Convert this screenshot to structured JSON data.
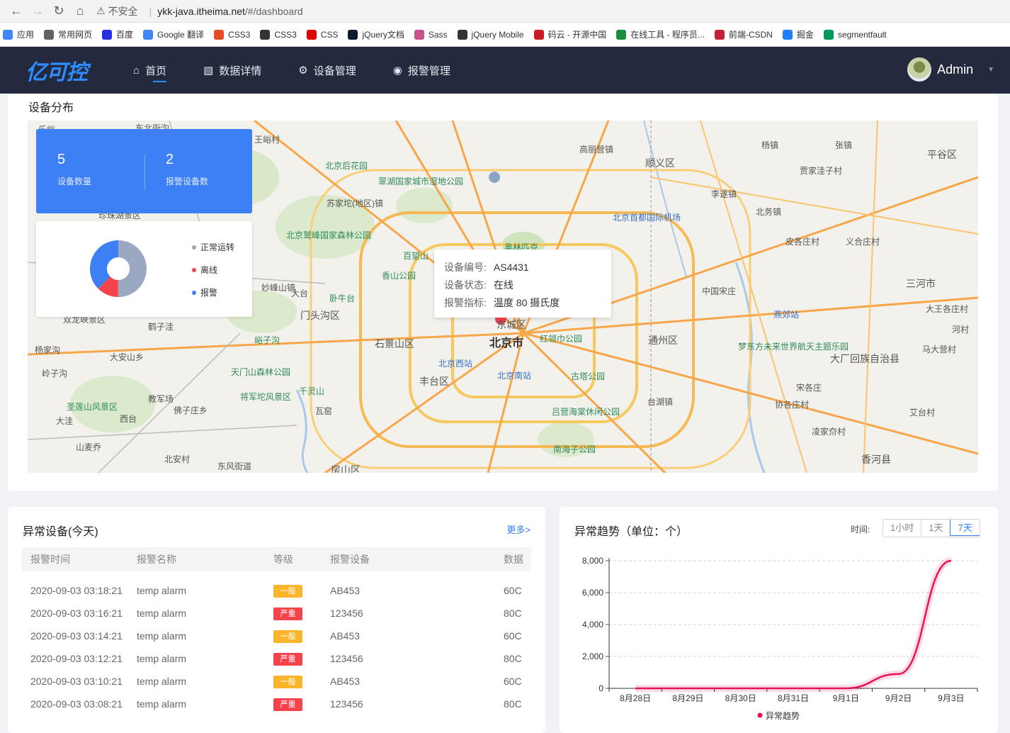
{
  "browser": {
    "not_secure": "不安全",
    "host": "ykk-java.itheima.net",
    "path": "/#/dashboard"
  },
  "bookmarks": [
    {
      "label": "应用",
      "color": "#4285f4"
    },
    {
      "label": "常用网页",
      "color": "#5f6368"
    },
    {
      "label": "百度",
      "color": "#2932e1"
    },
    {
      "label": "Google 翻译",
      "color": "#4285f4"
    },
    {
      "label": "CSS3",
      "color": "#e44d26"
    },
    {
      "label": "CSS3",
      "color": "#333333"
    },
    {
      "label": "CSS",
      "color": "#e00000"
    },
    {
      "label": "jQuery文档",
      "color": "#0f1b2d"
    },
    {
      "label": "Sass",
      "color": "#c6538c"
    },
    {
      "label": "jQuery Mobile",
      "color": "#333333"
    },
    {
      "label": "码云 - 开源中国",
      "color": "#c71d23"
    },
    {
      "label": "在线工具 - 程序员...",
      "color": "#1a8f3c"
    },
    {
      "label": "前端-CSDN",
      "color": "#c32136"
    },
    {
      "label": "掘金",
      "color": "#1e80ff"
    },
    {
      "label": "segmentfault",
      "color": "#009a61"
    }
  ],
  "header": {
    "logo": "亿可控",
    "nav": [
      {
        "label": "首页",
        "icon": "home-icon",
        "active": true
      },
      {
        "label": "数据详情",
        "icon": "chart-icon"
      },
      {
        "label": "设备管理",
        "icon": "gear-icon"
      },
      {
        "label": "报警管理",
        "icon": "signal-icon"
      }
    ],
    "user": "Admin"
  },
  "device_distribution": {
    "title": "设备分布",
    "device_count": "5",
    "device_count_label": "设备数量",
    "alarm_device_count": "2",
    "alarm_device_label": "报警设备数",
    "pie_legend": [
      {
        "label": "正常运转",
        "color": "#9aa8c2"
      },
      {
        "label": "离线",
        "color": "#f5434c"
      },
      {
        "label": "报警",
        "color": "#3d7ff5"
      }
    ],
    "tooltip": {
      "code_key": "设备编号:",
      "code_val": "AS4431",
      "status_key": "设备状态:",
      "status_val": "在线",
      "metric_key": "报警指标:",
      "metric_val": "温度 80 摄氏度"
    },
    "map_labels": [
      "北京市",
      "东城区",
      "石景山区",
      "门头沟区",
      "丰台区",
      "通州区",
      "顺义区",
      "平谷区",
      "三河市",
      "大厂回族自治县",
      "香河县",
      "房山区",
      "北京首都国际机场",
      "北京西站",
      "北京南站",
      "燕郊站",
      "奥林匹克",
      "百望山",
      "香山公园",
      "卧牛台",
      "北京后花园",
      "翠湖国家城市湿地公园",
      "北京鹫峰国家森林公园",
      "红领巾公园",
      "古塔公园",
      "吕营海棠休闲公园",
      "南海子公园",
      "梦东方未来世界航天主题乐园",
      "天门山森林公园",
      "将军坨风景区",
      "千灵山",
      "圣莲山风景区",
      "峪子沟",
      "高丽营镇",
      "杨镇",
      "张镇",
      "李遂镇",
      "北务镇",
      "皮各庄村",
      "义合庄村",
      "中国宋庄",
      "台湖镇",
      "宋各庄",
      "协各庄村",
      "凌家夼村",
      "艾台村",
      "马大营村",
      "河村",
      "大王各庄村",
      "贾家洼子村",
      "苏家坨(地区)镇",
      "妙峰山镇",
      "大台",
      "鹤子洼",
      "大安山乡",
      "杨家沟",
      "岭子沟",
      "佛子庄乡",
      "教军场",
      "西台",
      "大洼",
      "山麦乔",
      "北安村",
      "东风街道",
      "瓦窑",
      "珍珠湖景区",
      "双龙峡景区",
      "东北街沟",
      "王峪村",
      "乐峪"
    ]
  },
  "abnormal_devices": {
    "title": "异常设备(今天)",
    "more": "更多>",
    "columns": [
      "报警时间",
      "报警名称",
      "等级",
      "报警设备",
      "数据"
    ],
    "rows": [
      {
        "time": "2020-09-03 03:18:21",
        "name": "temp alarm",
        "level": "一般",
        "level_color": "#fbb52c",
        "device": "AB453",
        "data": "60C"
      },
      {
        "time": "2020-09-03 03:16:21",
        "name": "temp alarm",
        "level": "严重",
        "level_color": "#f5434c",
        "device": "123456",
        "data": "80C"
      },
      {
        "time": "2020-09-03 03:14:21",
        "name": "temp alarm",
        "level": "一般",
        "level_color": "#fbb52c",
        "device": "AB453",
        "data": "60C"
      },
      {
        "time": "2020-09-03 03:12:21",
        "name": "temp alarm",
        "level": "严重",
        "level_color": "#f5434c",
        "device": "123456",
        "data": "80C"
      },
      {
        "time": "2020-09-03 03:10:21",
        "name": "temp alarm",
        "level": "一般",
        "level_color": "#fbb52c",
        "device": "AB453",
        "data": "60C"
      },
      {
        "time": "2020-09-03 03:08:21",
        "name": "temp alarm",
        "level": "严重",
        "level_color": "#f5434c",
        "device": "123456",
        "data": "80C"
      }
    ]
  },
  "trend": {
    "title": "异常趋势（单位：个）",
    "time_label": "时间:",
    "ranges": [
      "1小时",
      "1天",
      "7天"
    ],
    "active_range": "7天"
  },
  "chart_data": {
    "type": "line",
    "title": "异常趋势（单位：个）",
    "x": [
      "8月28日",
      "8月29日",
      "8月30日",
      "8月31日",
      "9月1日",
      "9月2日",
      "9月3日"
    ],
    "series": [
      {
        "name": "异常趋势",
        "values": [
          0,
          0,
          0,
          0,
          0,
          900,
          8000
        ],
        "color": "#e8125c"
      }
    ],
    "ylim": [
      0,
      8000
    ],
    "yticks": [
      0,
      2000,
      4000,
      6000,
      8000
    ],
    "ytick_labels": [
      "0",
      "2,000",
      "4,000",
      "6,000",
      "8,000"
    ],
    "grid": true,
    "legend": "bottom"
  }
}
